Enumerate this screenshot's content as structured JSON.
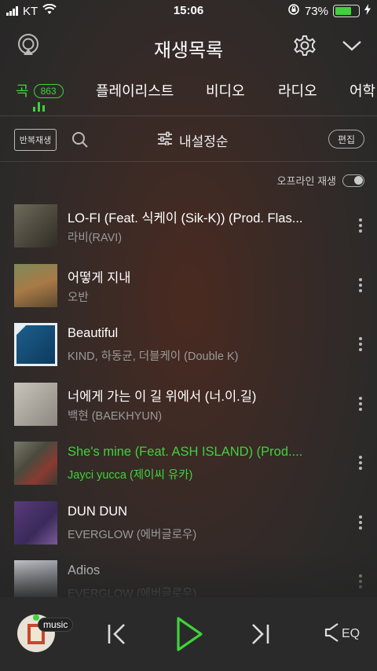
{
  "status": {
    "carrier": "KT",
    "time": "15:06",
    "battery": "73%"
  },
  "header": {
    "title": "재생목록"
  },
  "tabs": [
    {
      "label": "곡",
      "count": "863",
      "active": true
    },
    {
      "label": "플레이리스트"
    },
    {
      "label": "비디오"
    },
    {
      "label": "라디오"
    },
    {
      "label": "어학"
    }
  ],
  "toolbar": {
    "repeat_label": "반복재생",
    "sort_label": "내설정순",
    "edit_label": "편집"
  },
  "offline": {
    "label": "오프라인 재생"
  },
  "songs": [
    {
      "title": "LO-FI (Feat. 식케이 (Sik-K)) (Prod. Flas...",
      "artist": "라비(RAVI)"
    },
    {
      "title": "어떻게 지내",
      "artist": "오반"
    },
    {
      "title": "Beautiful",
      "artist": "KIND, 하동균, 더블케이 (Double K)"
    },
    {
      "title": "너에게 가는 이 길 위에서 (너.이.길)",
      "artist": "백현 (BAEKHYUN)"
    },
    {
      "title": "She's mine (Feat. ASH ISLAND) (Prod....",
      "artist": "Jayci yucca (제이씨 유카)",
      "playing": true
    },
    {
      "title": "DUN DUN",
      "artist": "EVERGLOW (에버글로우)"
    },
    {
      "title": "Adios",
      "artist": "EVERGLOW (에버글로우)"
    }
  ],
  "player": {
    "badge": "music",
    "eq_label": "EQ"
  },
  "colors": {
    "accent": "#3fd23a"
  }
}
